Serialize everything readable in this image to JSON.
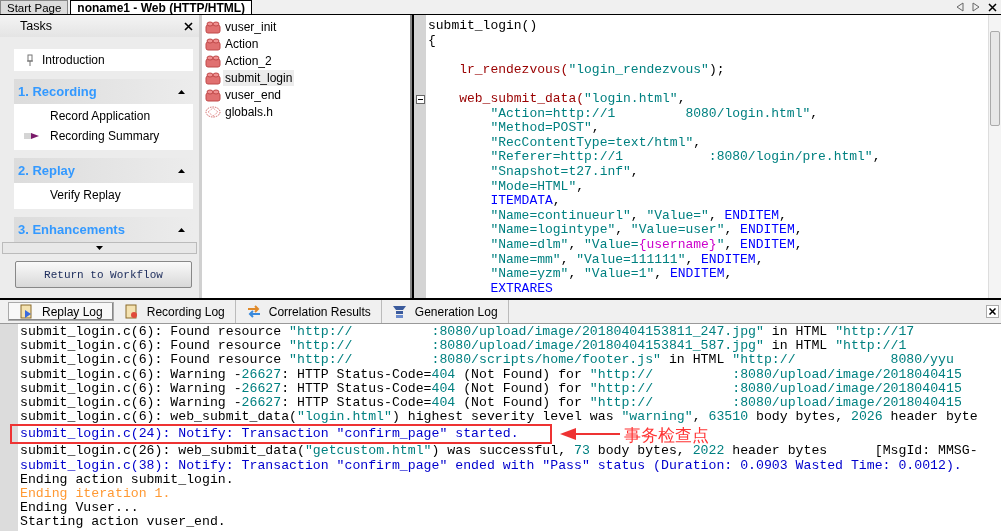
{
  "document_tabs": [
    {
      "label": "Start Page",
      "selected": false
    },
    {
      "label": "noname1 - Web (HTTP/HTML)",
      "selected": true
    }
  ],
  "tasks": {
    "title": "Tasks",
    "intro": "Introduction",
    "sections": [
      {
        "title": "1. Recording",
        "expanded": true,
        "items": [
          {
            "label": "Record Application",
            "current": false
          },
          {
            "label": "Recording Summary",
            "current": true
          }
        ]
      },
      {
        "title": "2. Replay",
        "expanded": true,
        "items": [
          {
            "label": "Verify Replay",
            "current": false
          }
        ]
      },
      {
        "title": "3. Enhancements",
        "expanded": true
      }
    ],
    "button": "Return to Workflow"
  },
  "files": [
    {
      "name": "vuser_init",
      "kind": "action",
      "selected": false
    },
    {
      "name": "Action",
      "kind": "action",
      "selected": false
    },
    {
      "name": "Action_2",
      "kind": "action",
      "selected": false
    },
    {
      "name": "submit_login",
      "kind": "action",
      "selected": true
    },
    {
      "name": "vuser_end",
      "kind": "action",
      "selected": false
    },
    {
      "name": "globals.h",
      "kind": "header",
      "selected": false
    }
  ],
  "editor": {
    "lines": [
      {
        "kind": "code",
        "fold": false,
        "segments": [
          {
            "kind": "plain",
            "text": "submit_login()"
          }
        ]
      },
      {
        "kind": "code",
        "fold": false,
        "segments": [
          {
            "kind": "plain",
            "text": "{"
          }
        ]
      },
      {
        "kind": "blank",
        "fold": false
      },
      {
        "kind": "code",
        "fold": false,
        "segments": [
          {
            "kind": "func",
            "text": "    lr_rendezvous("
          },
          {
            "kind": "str",
            "text": "\"login_rendezvous\""
          },
          {
            "kind": "plain",
            "text": ");"
          }
        ]
      },
      {
        "kind": "blank",
        "fold": false
      },
      {
        "kind": "code",
        "fold": true,
        "segments": [
          {
            "kind": "func",
            "text": "    web_submit_data("
          },
          {
            "kind": "str",
            "text": "\"login.html\""
          },
          {
            "kind": "plain",
            "text": ","
          }
        ]
      },
      {
        "kind": "code",
        "fold": false,
        "segments": [
          {
            "kind": "str",
            "text": "        \"Action=http://1         8080/login.html\""
          },
          {
            "kind": "plain",
            "text": ","
          }
        ]
      },
      {
        "kind": "code",
        "fold": false,
        "segments": [
          {
            "kind": "str",
            "text": "        \"Method=POST\""
          },
          {
            "kind": "plain",
            "text": ","
          }
        ]
      },
      {
        "kind": "code",
        "fold": false,
        "segments": [
          {
            "kind": "str",
            "text": "        \"RecContentType=text/html\""
          },
          {
            "kind": "plain",
            "text": ","
          }
        ]
      },
      {
        "kind": "code",
        "fold": false,
        "segments": [
          {
            "kind": "str",
            "text": "        \"Referer=http://1           :8080/login/pre.html\""
          },
          {
            "kind": "plain",
            "text": ","
          }
        ]
      },
      {
        "kind": "code",
        "fold": false,
        "segments": [
          {
            "kind": "str",
            "text": "        \"Snapshot=t27.inf\""
          },
          {
            "kind": "plain",
            "text": ","
          }
        ]
      },
      {
        "kind": "code",
        "fold": false,
        "segments": [
          {
            "kind": "str",
            "text": "        \"Mode=HTML\""
          },
          {
            "kind": "plain",
            "text": ","
          }
        ]
      },
      {
        "kind": "code",
        "fold": false,
        "segments": [
          {
            "kind": "kw",
            "text": "        ITEMDATA"
          },
          {
            "kind": "plain",
            "text": ","
          }
        ]
      },
      {
        "kind": "code",
        "fold": false,
        "segments": [
          {
            "kind": "str",
            "text": "        \"Name=continueurl\""
          },
          {
            "kind": "plain",
            "text": ", "
          },
          {
            "kind": "str",
            "text": "\"Value=\""
          },
          {
            "kind": "plain",
            "text": ", "
          },
          {
            "kind": "kw",
            "text": "ENDITEM"
          },
          {
            "kind": "plain",
            "text": ","
          }
        ]
      },
      {
        "kind": "code",
        "fold": false,
        "segments": [
          {
            "kind": "str",
            "text": "        \"Name=logintype\""
          },
          {
            "kind": "plain",
            "text": ", "
          },
          {
            "kind": "str",
            "text": "\"Value=user\""
          },
          {
            "kind": "plain",
            "text": ", "
          },
          {
            "kind": "kw",
            "text": "ENDITEM"
          },
          {
            "kind": "plain",
            "text": ","
          }
        ]
      },
      {
        "kind": "code",
        "fold": false,
        "segments": [
          {
            "kind": "str",
            "text": "        \"Name=dlm\""
          },
          {
            "kind": "plain",
            "text": ", "
          },
          {
            "kind": "str",
            "text": "\"Value="
          },
          {
            "kind": "param",
            "text": "{username}"
          },
          {
            "kind": "str",
            "text": "\""
          },
          {
            "kind": "plain",
            "text": ", "
          },
          {
            "kind": "kw",
            "text": "ENDITEM"
          },
          {
            "kind": "plain",
            "text": ","
          }
        ]
      },
      {
        "kind": "code",
        "fold": false,
        "segments": [
          {
            "kind": "str",
            "text": "        \"Name=mm\""
          },
          {
            "kind": "plain",
            "text": ", "
          },
          {
            "kind": "str",
            "text": "\"Value=111111\""
          },
          {
            "kind": "plain",
            "text": ", "
          },
          {
            "kind": "kw",
            "text": "ENDITEM"
          },
          {
            "kind": "plain",
            "text": ","
          }
        ]
      },
      {
        "kind": "code",
        "fold": false,
        "segments": [
          {
            "kind": "str",
            "text": "        \"Name=yzm\""
          },
          {
            "kind": "plain",
            "text": ", "
          },
          {
            "kind": "str",
            "text": "\"Value=1\""
          },
          {
            "kind": "plain",
            "text": ", "
          },
          {
            "kind": "kw",
            "text": "ENDITEM"
          },
          {
            "kind": "plain",
            "text": ","
          }
        ]
      },
      {
        "kind": "code",
        "fold": false,
        "segments": [
          {
            "kind": "kw",
            "text": "        EXTRARES"
          }
        ]
      }
    ]
  },
  "log_tabs": [
    {
      "label": "Replay Log",
      "selected": true
    },
    {
      "label": "Recording Log",
      "selected": false
    },
    {
      "label": "Correlation Results",
      "selected": false
    },
    {
      "label": "Generation Log",
      "selected": false
    }
  ],
  "log": [
    {
      "highlighted": false,
      "segments": [
        {
          "kind": "plain",
          "text": "submit_login.c(6): Found resource "
        },
        {
          "kind": "str",
          "text": "\"http://          :8080/upload/image/20180404153811_247.jpg\""
        },
        {
          "kind": "plain",
          "text": " in HTML "
        },
        {
          "kind": "str",
          "text": "\"http://17"
        }
      ]
    },
    {
      "highlighted": false,
      "segments": [
        {
          "kind": "plain",
          "text": "submit_login.c(6): Found resource "
        },
        {
          "kind": "str",
          "text": "\"http://          :8080/upload/image/20180404153841_587.jpg\""
        },
        {
          "kind": "plain",
          "text": " in HTML "
        },
        {
          "kind": "str",
          "text": "\"http://1"
        }
      ]
    },
    {
      "highlighted": false,
      "segments": [
        {
          "kind": "plain",
          "text": "submit_login.c(6): Found resource "
        },
        {
          "kind": "str",
          "text": "\"http://          :8080/scripts/home/footer.js\""
        },
        {
          "kind": "plain",
          "text": " in HTML "
        },
        {
          "kind": "str",
          "text": "\"http://            8080/yyu"
        }
      ]
    },
    {
      "highlighted": false,
      "segments": [
        {
          "kind": "plain",
          "text": "submit_login.c(6): Warning -"
        },
        {
          "kind": "str",
          "text": "26627"
        },
        {
          "kind": "plain",
          "text": ": HTTP Status-Code="
        },
        {
          "kind": "str",
          "text": "404"
        },
        {
          "kind": "plain",
          "text": " (Not Found) for "
        },
        {
          "kind": "str",
          "text": "\"http://          :8080/upload/image/2018040415"
        }
      ]
    },
    {
      "highlighted": false,
      "segments": [
        {
          "kind": "plain",
          "text": "submit_login.c(6): Warning -"
        },
        {
          "kind": "str",
          "text": "26627"
        },
        {
          "kind": "plain",
          "text": ": HTTP Status-Code="
        },
        {
          "kind": "str",
          "text": "404"
        },
        {
          "kind": "plain",
          "text": " (Not Found) for "
        },
        {
          "kind": "str",
          "text": "\"http://          :8080/upload/image/2018040415"
        }
      ]
    },
    {
      "highlighted": false,
      "segments": [
        {
          "kind": "plain",
          "text": "submit_login.c(6): Warning -"
        },
        {
          "kind": "str",
          "text": "26627"
        },
        {
          "kind": "plain",
          "text": ": HTTP Status-Code="
        },
        {
          "kind": "str",
          "text": "404"
        },
        {
          "kind": "plain",
          "text": " (Not Found) for "
        },
        {
          "kind": "str",
          "text": "\"http://          :8080/upload/image/2018040415"
        }
      ]
    },
    {
      "highlighted": false,
      "segments": [
        {
          "kind": "plain",
          "text": "submit_login.c(6): web_submit_data("
        },
        {
          "kind": "str",
          "text": "\"login.html\""
        },
        {
          "kind": "plain",
          "text": ") highest severity level was "
        },
        {
          "kind": "str",
          "text": "\"warning\""
        },
        {
          "kind": "plain",
          "text": ", "
        },
        {
          "kind": "str",
          "text": "63510"
        },
        {
          "kind": "plain",
          "text": " body bytes, "
        },
        {
          "kind": "str",
          "text": "2026"
        },
        {
          "kind": "plain",
          "text": " header byte"
        }
      ]
    },
    {
      "highlighted": true,
      "segments": [
        {
          "kind": "notify",
          "text": "submit_login.c(24): Notify: Transaction \"confirm_page\" started."
        }
      ]
    },
    {
      "highlighted": false,
      "segments": [
        {
          "kind": "plain",
          "text": "submit_login.c(26): web_submit_data("
        },
        {
          "kind": "str",
          "text": "\"getcustom.html\""
        },
        {
          "kind": "plain",
          "text": ") was successful, "
        },
        {
          "kind": "str",
          "text": "73"
        },
        {
          "kind": "plain",
          "text": " body bytes, "
        },
        {
          "kind": "str",
          "text": "2022"
        },
        {
          "kind": "plain",
          "text": " header bytes      [MsgId: MMSG-"
        }
      ]
    },
    {
      "highlighted": false,
      "segments": [
        {
          "kind": "notify",
          "text": "submit_login.c(38): Notify: Transaction \"confirm_page\" ended with \"Pass\" status (Duration: 0.0903 Wasted Time: 0.0012)."
        }
      ]
    },
    {
      "highlighted": false,
      "segments": [
        {
          "kind": "plain",
          "text": "Ending action submit_login."
        }
      ]
    },
    {
      "highlighted": false,
      "segments": [
        {
          "kind": "orange",
          "text": "Ending iteration 1."
        }
      ]
    },
    {
      "highlighted": false,
      "segments": [
        {
          "kind": "plain",
          "text": "Ending Vuser..."
        }
      ]
    },
    {
      "highlighted": false,
      "segments": [
        {
          "kind": "plain",
          "text": "Starting action vuser_end."
        }
      ]
    }
  ],
  "annotation": {
    "label": "事务检查点"
  }
}
